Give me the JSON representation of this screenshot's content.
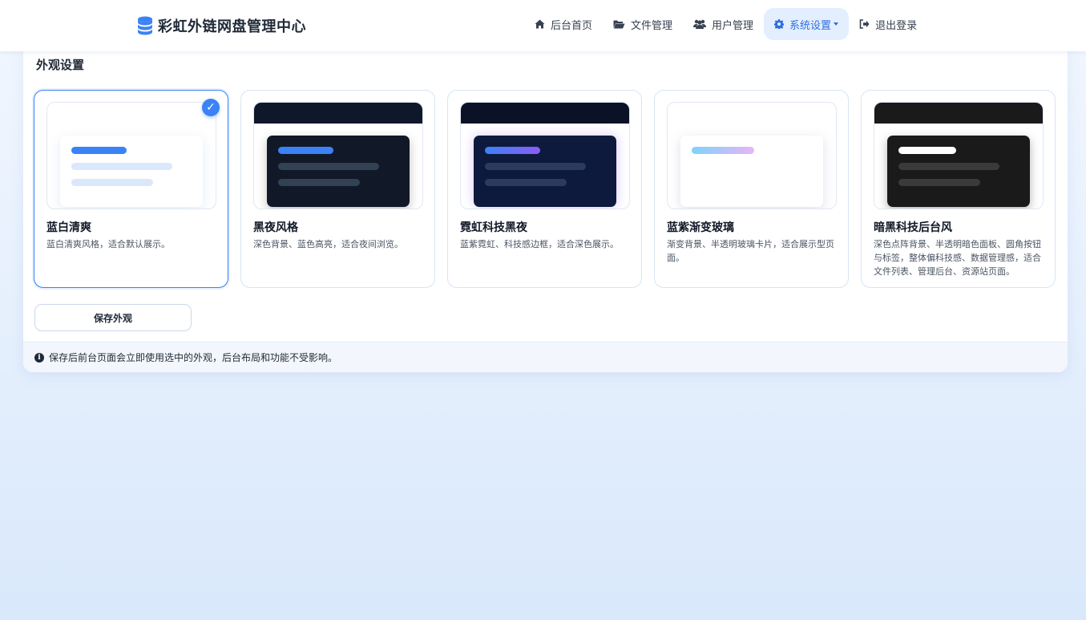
{
  "brand": {
    "title": "彩虹外链网盘管理中心",
    "icon": "database-icon",
    "icon_color": "#3b82f6"
  },
  "nav": {
    "items": [
      {
        "label": "后台首页",
        "icon": "home-icon"
      },
      {
        "label": "文件管理",
        "icon": "folder-open-icon"
      },
      {
        "label": "用户管理",
        "icon": "users-icon"
      },
      {
        "label": "系统设置",
        "icon": "gear-icon",
        "active": true,
        "has_dropdown": true
      },
      {
        "label": "退出登录",
        "icon": "sign-out-icon"
      }
    ]
  },
  "panel": {
    "title": "外观设置",
    "save_label": "保存外观",
    "note": "保存后前台页面会立即使用选中的外观，后台布局和功能不受影响。",
    "note_icon": "info-circle-icon"
  },
  "themes": [
    {
      "name": "蓝白清爽",
      "desc": "蓝白清爽风格，适合默认展示。",
      "selected": true,
      "colors": {
        "topbar": "#ffffff",
        "bg": "#ffffff",
        "inner": "#ffffff",
        "accent": "#3b82f6",
        "line": "#dbe7fa"
      }
    },
    {
      "name": "黑夜风格",
      "desc": "深色背景、蓝色高亮，适合夜间浏览。",
      "selected": false,
      "colors": {
        "topbar": "#0f172a",
        "bg": "#ffffff",
        "inner": "#111827",
        "accent": "#3b82f6",
        "line": "#334155"
      }
    },
    {
      "name": "霓虹科技黑夜",
      "desc": "蓝紫霓虹、科技感边框，适合深色展示。",
      "selected": false,
      "colors": {
        "topbar": "#0b1228",
        "bg": "#ffffff",
        "inner": "#0e1a3d",
        "accent_from": "#3b82f6",
        "accent_to": "#8b5cf6",
        "line": "#2c3a5e"
      }
    },
    {
      "name": "蓝紫渐变玻璃",
      "desc": "渐变背景、半透明玻璃卡片，适合展示型页面。",
      "selected": false,
      "colors": {
        "topbar": "#ffffff",
        "bg": "#ffffff",
        "inner": "#ffffff",
        "accent_from": "#7dd3fc",
        "accent_to": "#e9b5f5",
        "line": "#ffffff"
      }
    },
    {
      "name": "暗黑科技后台风",
      "desc": "深色点阵背景、半透明暗色面板、圆角按钮与标签，整体偏科技感、数据管理感，适合文件列表、管理后台、资源站页面。",
      "selected": false,
      "colors": {
        "topbar": "#1a1a1a",
        "bg": "#ffffff",
        "inner": "#1a1a1a",
        "accent": "#ffffff",
        "line": "#3a3a3a"
      }
    }
  ]
}
